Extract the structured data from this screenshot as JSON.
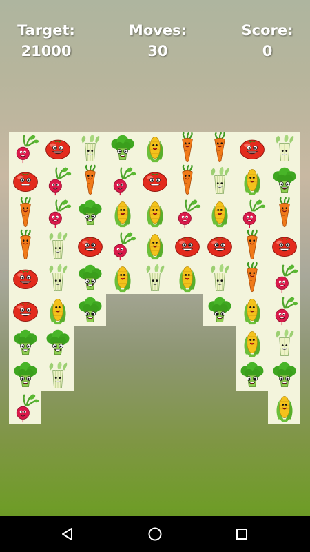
{
  "hud": {
    "target_label": "Target:",
    "target_value": "21000",
    "moves_label": "Moves:",
    "moves_value": "30",
    "score_label": "Score:",
    "score_value": "0"
  },
  "board": {
    "columns": 9,
    "rows": 9,
    "grid": [
      [
        "radish",
        "tomato",
        "celery",
        "broccoli",
        "corn",
        "carrot",
        "carrot",
        "tomato",
        "celery"
      ],
      [
        "tomato",
        "radish",
        "carrot",
        "radish",
        "tomato",
        "carrot",
        "celery",
        "corn",
        "broccoli"
      ],
      [
        "carrot",
        "radish",
        "broccoli",
        "corn",
        "corn",
        "radish",
        "corn",
        "radish",
        "carrot"
      ],
      [
        "carrot",
        "celery",
        "tomato",
        "radish",
        "corn",
        "tomato",
        "tomato",
        "carrot",
        "tomato"
      ],
      [
        "tomato",
        "celery",
        "broccoli",
        "corn",
        "celery",
        "corn",
        "celery",
        "carrot",
        "radish"
      ],
      [
        "tomato",
        "corn",
        "broccoli",
        null,
        null,
        null,
        "broccoli",
        "corn",
        "radish"
      ],
      [
        "broccoli",
        "broccoli",
        null,
        null,
        null,
        null,
        null,
        "corn",
        "celery"
      ],
      [
        "broccoli",
        "celery",
        null,
        null,
        null,
        null,
        null,
        "broccoli",
        "broccoli"
      ],
      [
        "radish",
        null,
        null,
        null,
        null,
        null,
        null,
        null,
        "corn"
      ]
    ]
  },
  "colors": {
    "tile_bg": "#f3f4dc",
    "tomato": "#e32b1d",
    "carrot": "#f07a1a",
    "broccoli": "#3ea620",
    "corn": "#f4c21c",
    "radish": "#d9194a",
    "celery": "#9cc77a"
  },
  "navbar": {
    "back_icon": "back-triangle-icon",
    "home_icon": "home-circle-icon",
    "recents_icon": "recents-square-icon"
  }
}
